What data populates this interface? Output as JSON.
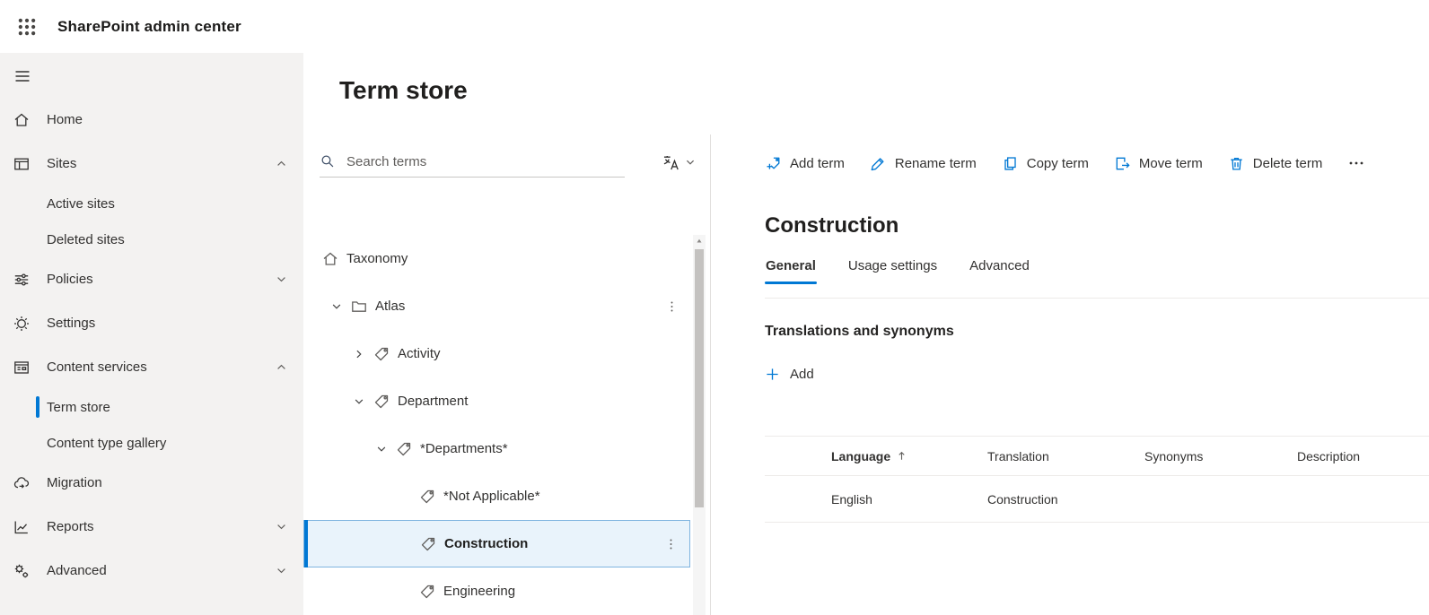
{
  "topbar": {
    "title": "SharePoint admin center",
    "waffle_icon": "waffle-icon"
  },
  "sidebar": {
    "hamburger_icon": "hamburger-icon",
    "items": [
      {
        "label": "Home",
        "icon": "home-icon"
      },
      {
        "label": "Sites",
        "icon": "sites-icon",
        "chevron": "up"
      },
      {
        "label": "Active sites",
        "sub": true
      },
      {
        "label": "Deleted sites",
        "sub": true
      },
      {
        "label": "Policies",
        "icon": "policies-icon",
        "chevron": "down"
      },
      {
        "label": "Settings",
        "icon": "settings-icon"
      },
      {
        "label": "Content services",
        "icon": "content-services-icon",
        "chevron": "up"
      },
      {
        "label": "Term store",
        "sub": true,
        "selected": true
      },
      {
        "label": "Content type gallery",
        "sub": true
      },
      {
        "label": "Migration",
        "icon": "migration-icon"
      },
      {
        "label": "Reports",
        "icon": "reports-icon",
        "chevron": "down"
      },
      {
        "label": "Advanced",
        "icon": "advanced-icon",
        "chevron": "down"
      }
    ]
  },
  "main": {
    "page_title": "Term store",
    "search": {
      "placeholder": "Search terms",
      "icon": "search-icon"
    },
    "language_button": {
      "icon": "translate-icon",
      "chevron": "chevron-down-icon"
    },
    "tree": {
      "items": [
        {
          "label": "Taxonomy",
          "icon": "home-icon",
          "level": 0
        },
        {
          "label": "Atlas",
          "icon": "folder-icon",
          "level": 1,
          "expanded": true,
          "menu": true
        },
        {
          "label": "Activity",
          "icon": "tag-icon",
          "level": 2,
          "expanded": false
        },
        {
          "label": "Department",
          "icon": "tag-icon",
          "level": 2,
          "expanded": true
        },
        {
          "label": "*Departments*",
          "icon": "tag-icon",
          "level": 3,
          "expanded": true
        },
        {
          "label": "*Not Applicable*",
          "icon": "tag-icon",
          "level": 4
        },
        {
          "label": "Construction",
          "icon": "tag-icon",
          "level": 4,
          "selected": true,
          "menu": true
        },
        {
          "label": "Engineering",
          "icon": "tag-icon",
          "level": 4
        }
      ]
    },
    "toolbar": {
      "items": [
        {
          "label": "Add term",
          "icon": "add-term-icon"
        },
        {
          "label": "Rename term",
          "icon": "rename-icon"
        },
        {
          "label": "Copy term",
          "icon": "copy-icon"
        },
        {
          "label": "Move term",
          "icon": "move-icon"
        },
        {
          "label": "Delete term",
          "icon": "delete-icon"
        }
      ],
      "overflow_icon": "more-icon"
    },
    "detail": {
      "title": "Construction",
      "tabs": [
        "General",
        "Usage settings",
        "Advanced"
      ],
      "selected_tab": "General",
      "section_title": "Translations and synonyms",
      "add_label": "Add",
      "table": {
        "columns": [
          "Language",
          "Translation",
          "Synonyms",
          "Description"
        ],
        "sorted_by": "Language",
        "sort_direction": "ascending",
        "rows": [
          {
            "language": "English",
            "translation": "Construction",
            "synonyms": "",
            "description": ""
          }
        ]
      }
    }
  },
  "colors": {
    "accent": "#0078d4",
    "sidebar_bg": "#f3f2f1",
    "text": "#323130",
    "selected_row_bg": "#e9f3fb",
    "selected_row_border": "#7fb4e0"
  }
}
